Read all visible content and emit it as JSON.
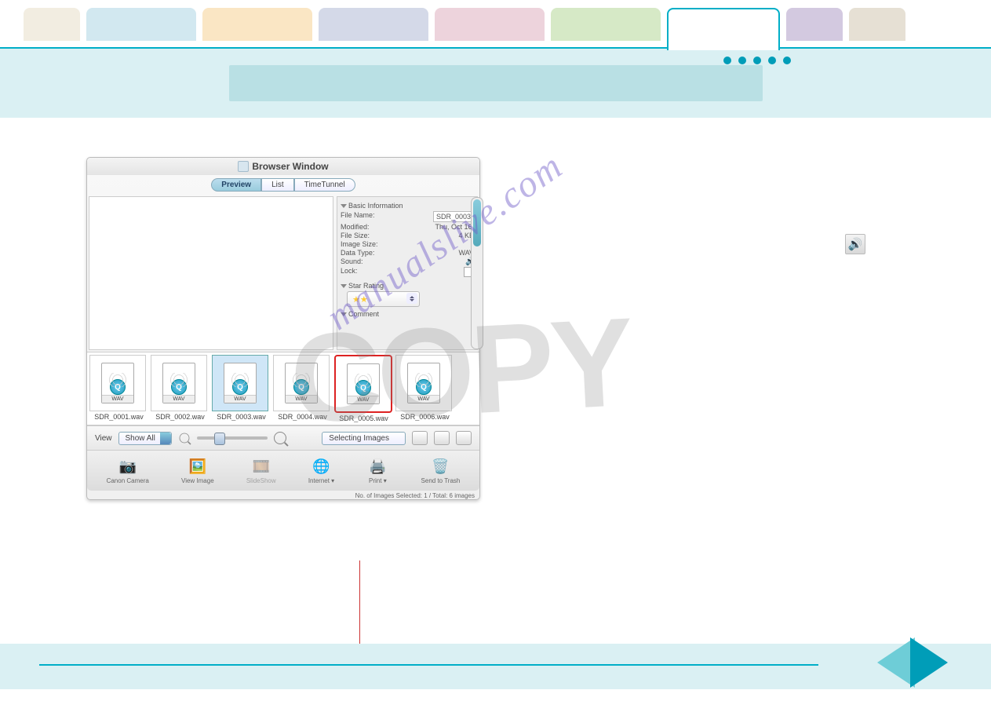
{
  "window_title": "Browser Window",
  "seg": {
    "preview": "Preview",
    "list": "List",
    "timetunnel": "TimeTunnel"
  },
  "info": {
    "section_basic": "Basic Information",
    "filename_label": "File Name:",
    "filename": "SDR_0003",
    "modified_label": "Modified:",
    "modified": "Thu, Oct 16,",
    "filesize_label": "File Size:",
    "filesize": "4 KB",
    "imagesize_label": "Image Size:",
    "imagesize": "",
    "datatype_label": "Data Type:",
    "datatype": "WAV",
    "sound_label": "Sound:",
    "lock_label": "Lock:",
    "section_star": "Star Rating",
    "section_comment": "Comment"
  },
  "wav_label": "WAV",
  "thumbnails": [
    {
      "name": "SDR_0001.wav"
    },
    {
      "name": "SDR_0002.wav"
    },
    {
      "name": "SDR_0003.wav"
    },
    {
      "name": "SDR_0004.wav"
    },
    {
      "name": "SDR_0005.wav"
    },
    {
      "name": "SDR_0006.wav"
    }
  ],
  "view_label": "View",
  "view_dd": "Show All",
  "select_dd": "Selecting Images",
  "toolbar": {
    "canon": "Canon Camera",
    "viewimg": "View Image",
    "slideshow": "SlideShow",
    "internet": "Internet",
    "print": "Print",
    "trash": "Send to Trash"
  },
  "status": "No. of Images Selected: 1 / Total: 6 images",
  "watermark_url": "manualslive.com",
  "watermark_copy": "COPY"
}
